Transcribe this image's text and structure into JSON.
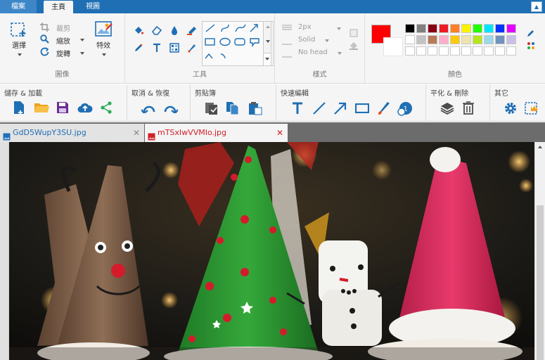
{
  "menu": {
    "file": "檔案",
    "home": "主頁",
    "view": "視圖"
  },
  "ribbon": {
    "image_group": {
      "label": "圖像",
      "select": "選擇",
      "crop": "裁剪",
      "resize": "縮放",
      "rotate": "旋轉",
      "effects": "特效"
    },
    "tools_group": {
      "label": "工具"
    },
    "style_group": {
      "label": "樣式",
      "size": "2px",
      "line": "Solid",
      "fill": "No head"
    },
    "colors_group": {
      "label": "顏色",
      "primary": "#ff0000",
      "secondary": "#ffffff",
      "palette_row1": [
        "#000000",
        "#7f7f7f",
        "#880015",
        "#ed1c24",
        "#ff7f27",
        "#fff200",
        "#22ff00",
        "#00e5ff",
        "#0033ff",
        "#e100ff"
      ],
      "palette_row2": [
        "#ffffff",
        "#c3c3c3",
        "#b97a57",
        "#ffaec9",
        "#ffc90e",
        "#efe4b0",
        "#b5e61d",
        "#99d9ea",
        "#7092be",
        "#c8bfe7"
      ]
    }
  },
  "quickbar": {
    "save_share": "儲存 & 加載",
    "undo_redo": "取消 & 恢復",
    "clipboard": "剪貼簿",
    "quick_edit": "快速編輯",
    "flatten_delete": "平化 & 刪除",
    "other": "其它"
  },
  "doc_tabs": [
    {
      "title": "GdD5WupY3SU.jpg",
      "active": false
    },
    {
      "title": "mTSxIwVVMIo.jpg",
      "active": true
    }
  ]
}
